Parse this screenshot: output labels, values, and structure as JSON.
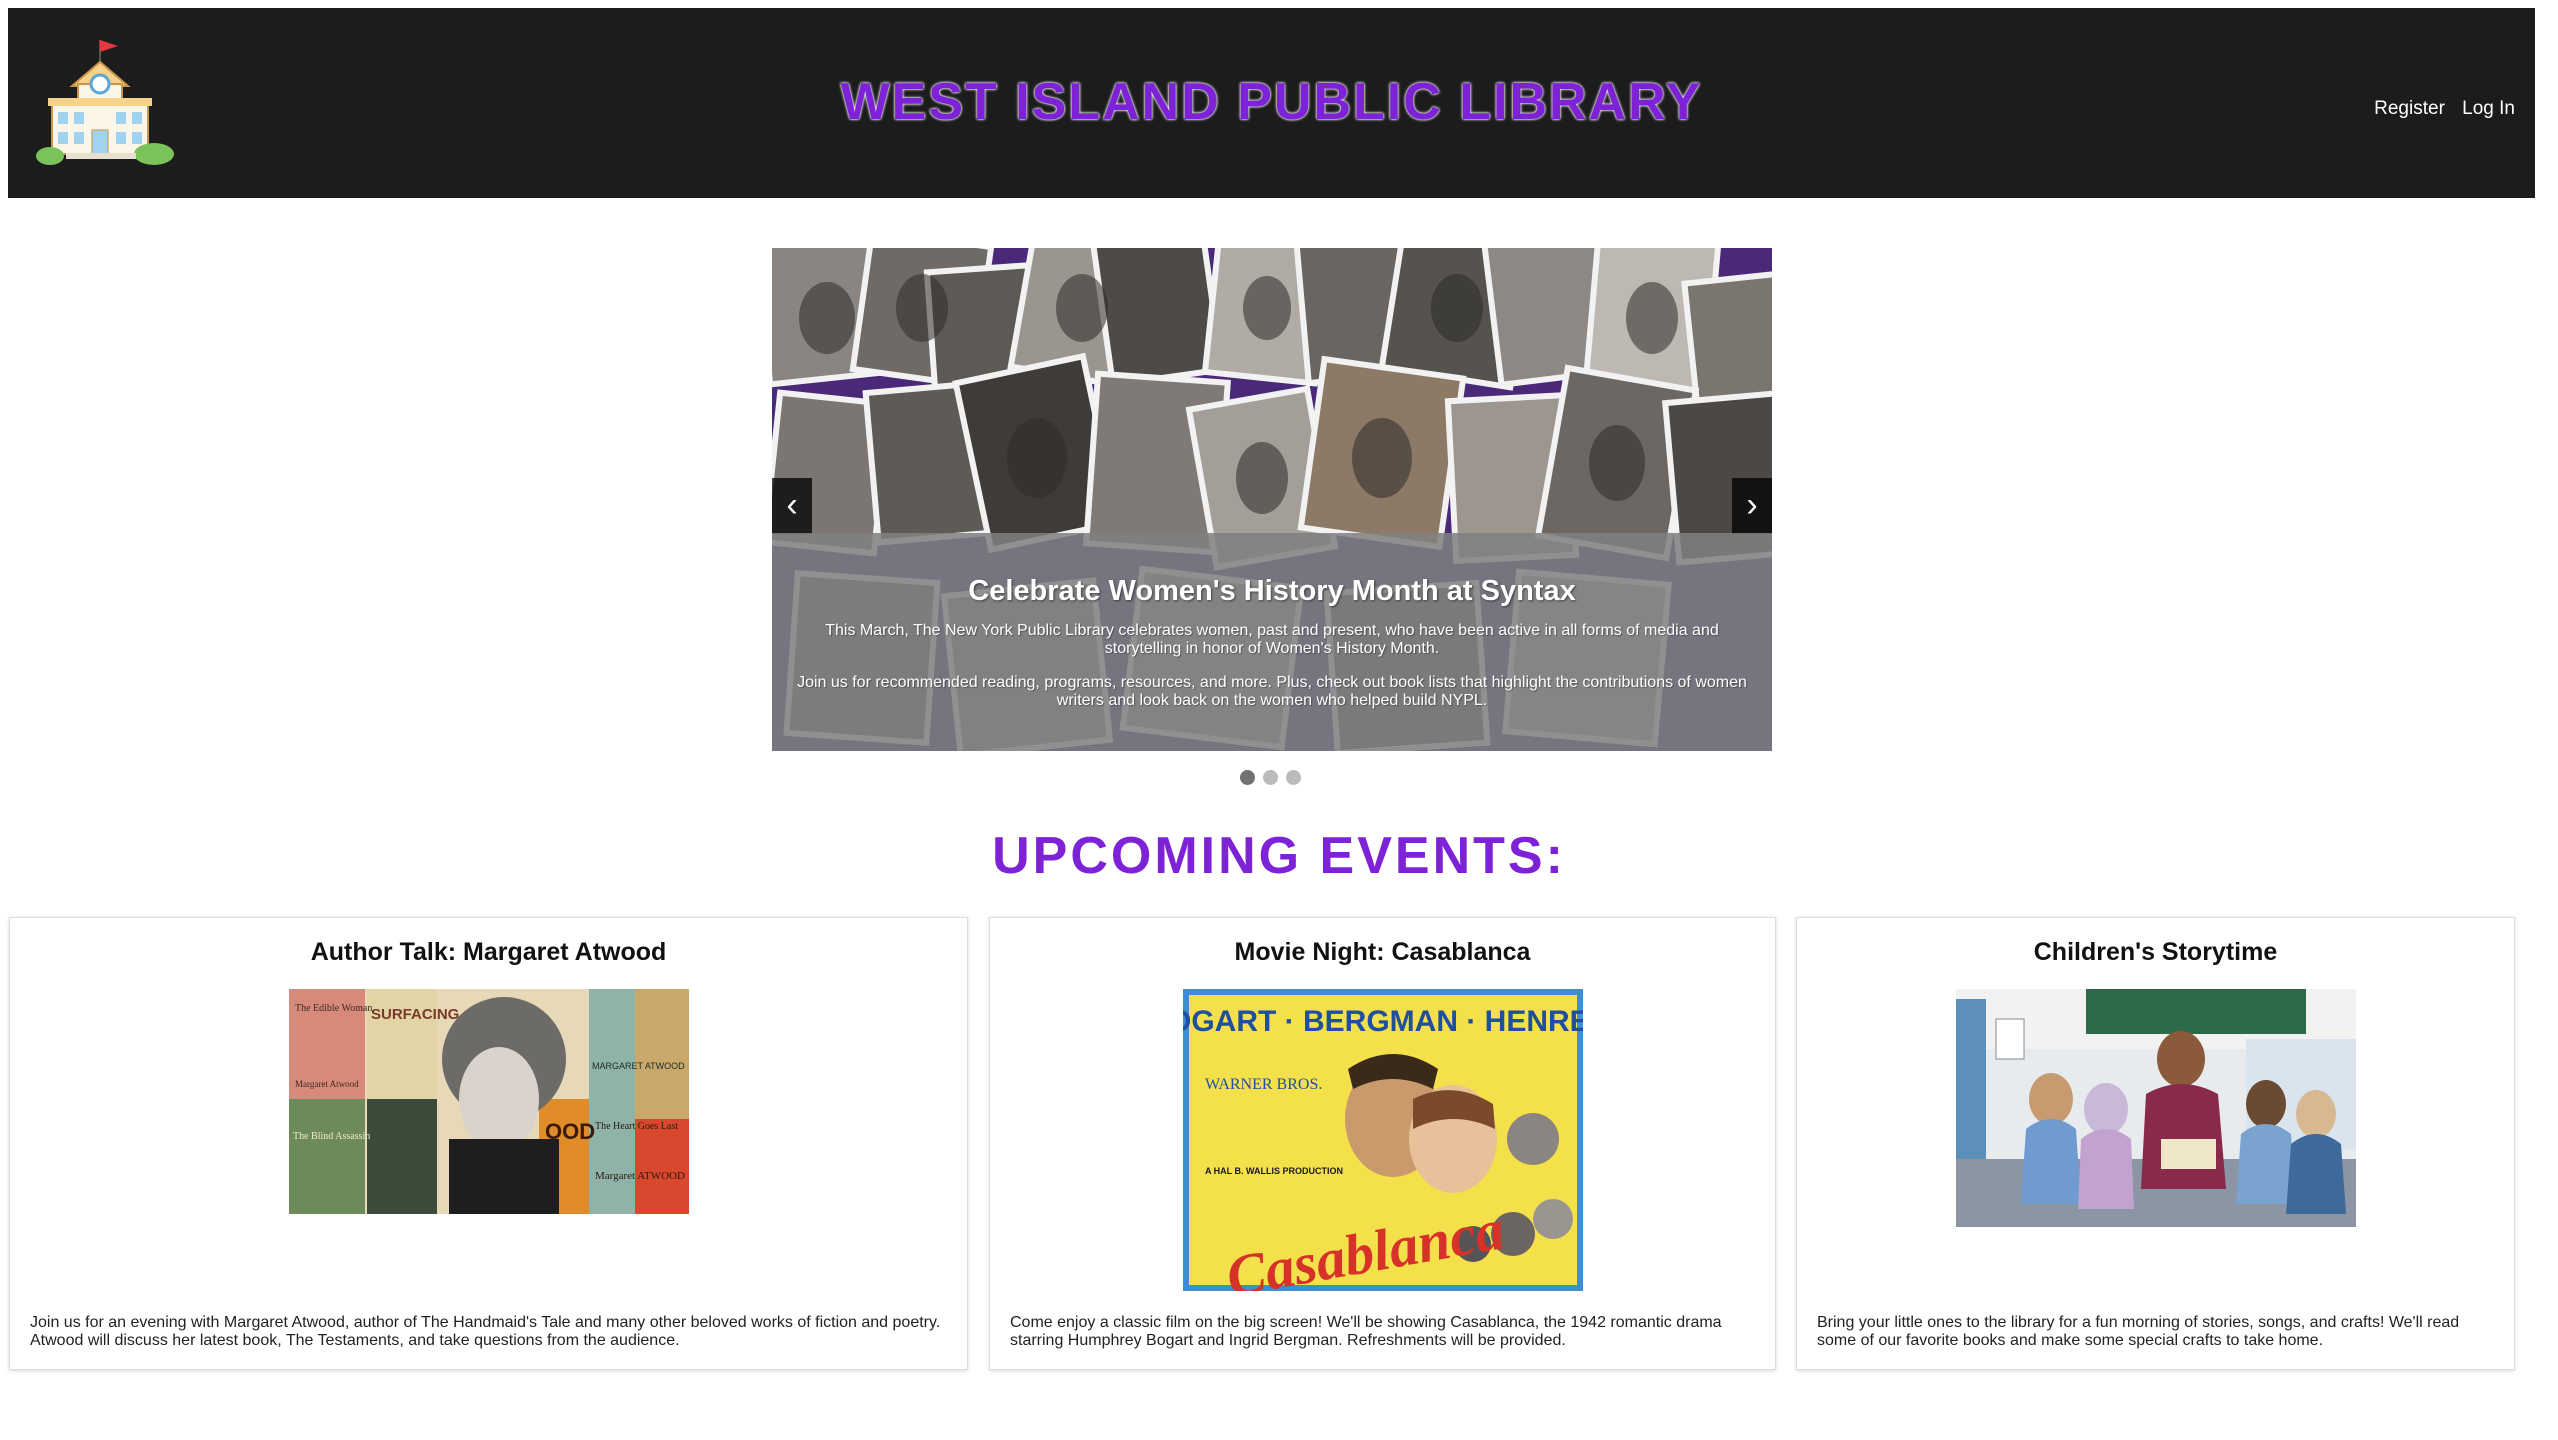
{
  "header": {
    "title": "WEST ISLAND PUBLIC LIBRARY",
    "register_label": "Register",
    "login_label": "Log In"
  },
  "slider": {
    "title": "Celebrate Women's History Month at Syntax",
    "paragraph1": "This March, The New York Public Library celebrates women, past and present, who have been active in all forms of media and storytelling in honor of Women's History Month.",
    "paragraph2": "Join us for recommended reading, programs, resources, and more. Plus, check out book lists that highlight the contributions of women writers and look back on the women who helped build NYPL.",
    "prev_icon": "‹",
    "next_icon": "›",
    "slide_count": 3,
    "active_slide": 1
  },
  "events": {
    "heading": "UPCOMING EVENTS:",
    "cards": [
      {
        "title": "Author Talk: Margaret Atwood",
        "description": "Join us for an evening with Margaret Atwood, author of The Handmaid's Tale and many other beloved works of fiction and poetry. Atwood will discuss her latest book, The Testaments, and take questions from the audience.",
        "poster_text": {
          "b1": "The Edible Woman",
          "b2": "SURFACING",
          "b3": "Margaret Atwood",
          "b4": "MARGARET ATWOOD",
          "b5": "The Heart Goes Last",
          "b6": "Margaret ATWOOD",
          "b7": "The Blind Assassin",
          "b8": "OOD"
        }
      },
      {
        "title": "Movie Night: Casablanca",
        "description": "Come enjoy a classic film on the big screen! We'll be showing Casablanca, the 1942 romantic drama starring Humphrey Bogart and Ingrid Bergman. Refreshments will be provided.",
        "poster_text": {
          "names": "BOGART · BERGMAN · HENREID",
          "studio": "WARNER BROS.",
          "production": "A HAL B. WALLIS PRODUCTION",
          "film": "Casablanca"
        }
      },
      {
        "title": "Children's Storytime",
        "description": "Bring your little ones to the library for a fun morning of stories, songs, and crafts! We'll read some of our favorite books and make some special crafts to take home."
      }
    ]
  },
  "colors": {
    "accent": "#7d22d6",
    "header_bg": "#1c1c1c",
    "caption_bg": "#808080"
  }
}
